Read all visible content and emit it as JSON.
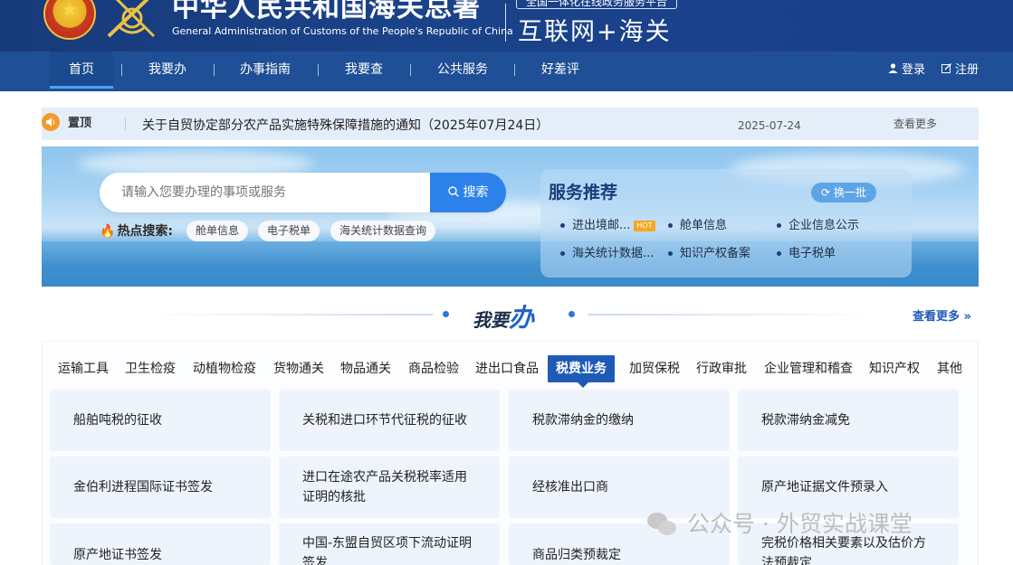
{
  "header": {
    "title_cn": "中华人民共和国海关总署",
    "title_en": "General Administration of Customs of the People's Republic of China",
    "platform_sub": "全国一体化在线政务服务平台",
    "platform_main": "互联网+海关"
  },
  "nav": {
    "items": [
      "首页",
      "我要办",
      "办事指南",
      "我要查",
      "公共服务",
      "好差评"
    ],
    "login": "登录",
    "register": "注册"
  },
  "notice": {
    "pin_label": "置顶",
    "text": "关于自贸协定部分农产品实施特殊保障措施的通知（2025年07月24日）",
    "date": "2025-07-24",
    "more": "查看更多"
  },
  "search": {
    "placeholder": "请输入您要办理的事项或服务",
    "button": "搜索",
    "hot_label": "热点搜索:",
    "hot_tags": [
      "舱单信息",
      "电子税单",
      "海关统计数据查询"
    ]
  },
  "services": {
    "title": "服务推荐",
    "refresh": "换一批",
    "hot_badge": "HOT",
    "items": [
      "进出境邮...",
      "舱单信息",
      "企业信息公示",
      "海关统计数据...",
      "知识产权备案",
      "电子税单"
    ]
  },
  "section": {
    "title_a": "我要",
    "title_b": "办",
    "more": "查看更多 »"
  },
  "tabs": [
    "运输工具",
    "卫生检疫",
    "动植物检疫",
    "货物通关",
    "物品通关",
    "商品检验",
    "进出口食品",
    "税费业务",
    "加贸保税",
    "行政审批",
    "企业管理和稽查",
    "知识产权",
    "其他"
  ],
  "active_tab": "税费业务",
  "cards": [
    "船舶吨税的征收",
    "关税和进口环节代征税的征收",
    "税款滞纳金的缴纳",
    "税款滞纳金减免",
    "金伯利进程国际证书签发",
    "进口在途农产品关税税率适用证明的核批",
    "经核准出口商",
    "原产地证据文件预录入",
    "原产地证书签发",
    "中国-东盟自贸区项下流动证明签发",
    "商品归类预裁定",
    "完税价格相关要素以及估价方法预裁定"
  ],
  "watermark": {
    "text": "公众号 · 外贸实战课堂"
  },
  "colors": {
    "header_bg": "#1a4289",
    "nav_bg": "#1f4f96",
    "accent": "#1f5bb5",
    "search_button": "#2c82e8",
    "card_bg": "#eef4fc",
    "hot_badge": "#f5a623"
  }
}
